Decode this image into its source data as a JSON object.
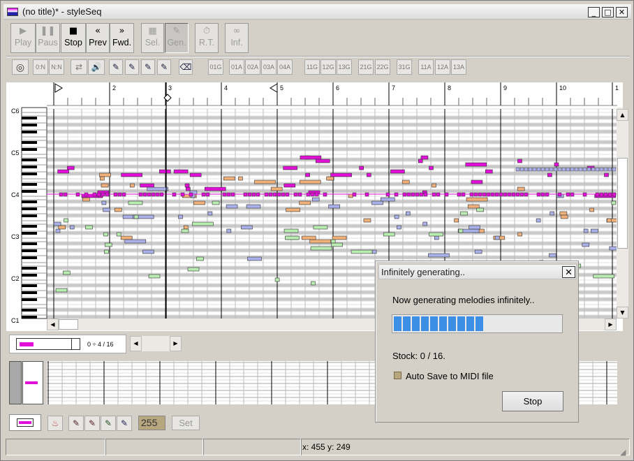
{
  "window": {
    "title": "(no title)* - styleSeq",
    "min_label": "_",
    "max_label": "□",
    "close_label": "✕"
  },
  "toolbar": {
    "buttons": [
      {
        "name": "play-button",
        "icon": "▶",
        "label": "Play",
        "disabled": true
      },
      {
        "name": "pause-button",
        "icon": "❚❚",
        "label": "Paus",
        "disabled": true
      },
      {
        "name": "stop-button",
        "icon": "■",
        "label": "Stop",
        "disabled": false
      },
      {
        "name": "prev-button",
        "icon": "«",
        "label": "Prev",
        "disabled": false
      },
      {
        "name": "forward-button",
        "icon": "»",
        "label": "Fwd.",
        "disabled": false
      },
      {
        "name": "select-button",
        "icon": "▦",
        "label": "Sel.",
        "disabled": true
      },
      {
        "name": "generate-button",
        "icon": "✎",
        "label": "Gen.",
        "disabled": true,
        "pressed": true
      },
      {
        "name": "realtime-button",
        "icon": "⏱",
        "label": "R.T.",
        "disabled": true
      },
      {
        "name": "infinite-button",
        "icon": "∞",
        "label": "Inf.",
        "disabled": true
      }
    ]
  },
  "toolbar2": {
    "group1": [
      "0:N",
      "N:N"
    ],
    "group2": [
      "01G"
    ],
    "group3": [
      "01A",
      "02A",
      "03A",
      "04A"
    ],
    "group4": [
      "11G",
      "12G",
      "13G"
    ],
    "group5": [
      "21G",
      "22G"
    ],
    "group6": [
      "31G"
    ],
    "group7": [
      "11A",
      "12A",
      "13A"
    ]
  },
  "ruler": {
    "measures": [
      "1",
      "2",
      "3",
      "4",
      "5",
      "6",
      "7",
      "8",
      "9",
      "10",
      "1"
    ]
  },
  "keyboard": {
    "octave_labels": [
      "C6",
      "C5",
      "C4",
      "C3",
      "C2",
      "C1"
    ]
  },
  "pattern": {
    "counter": "0 ÷ 4 / 16"
  },
  "bottom_toolbar": {
    "velocity_value": "255",
    "set_label": "Set"
  },
  "dialog": {
    "title": "Infinitely generating..",
    "message": "Now generating melodies infinitely..",
    "progress_fraction": 0.65,
    "stock_text": "Stock: 0 / 16.",
    "autosave_label": "Auto Save to MIDI file",
    "autosave_checked": true,
    "stop_label": "Stop"
  },
  "statusbar": {
    "cursor_readout": "x: 455 y: 249"
  },
  "colors": {
    "magenta": "#e010d8",
    "orange": "#f0b07a",
    "blue": "#aab0e8",
    "green": "#b8ecb0",
    "progress": "#3c8fe4"
  }
}
